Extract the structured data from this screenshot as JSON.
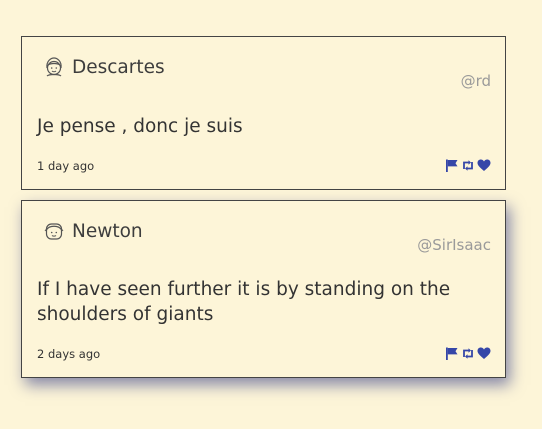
{
  "colors": {
    "background": "#fdf5d8",
    "card_border": "#444444",
    "accent": "#3546a8",
    "handle_text": "#9a9a9a"
  },
  "posts": [
    {
      "author": "Descartes",
      "handle": "@rd",
      "text": "Je pense , donc je suis",
      "time": "1 day ago",
      "avatar_icon": "person-icon",
      "actions": [
        "flag-icon",
        "retweet-icon",
        "heart-icon"
      ]
    },
    {
      "author": "Newton",
      "handle": "@SirIsaac",
      "text": "If I have seen further it is by standing on the shoulders of giants",
      "time": "2 days ago",
      "avatar_icon": "person-icon",
      "actions": [
        "flag-icon",
        "retweet-icon",
        "heart-icon"
      ]
    }
  ]
}
